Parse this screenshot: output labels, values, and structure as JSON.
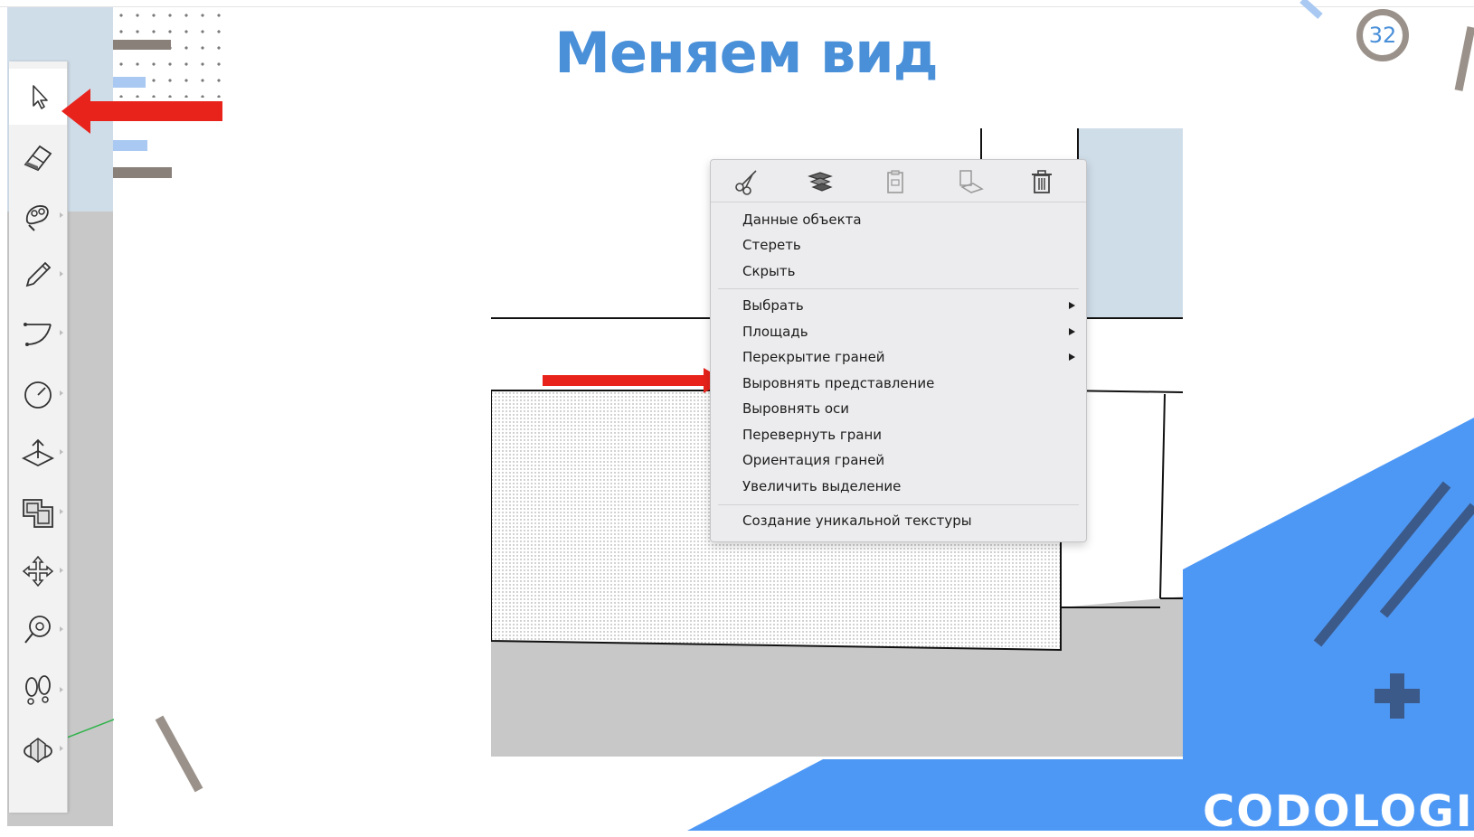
{
  "slide": {
    "title": "Меняем вид",
    "page_number": "32",
    "logo": "CODOLOGIA",
    "colors": {
      "title": "#4a90d9",
      "accent_blue": "#4e98f5",
      "dark_blue": "#3b5a8a",
      "arrow_red": "#e8231b",
      "gray": "#9a918a"
    }
  },
  "toolbar": {
    "tools": [
      {
        "name": "select",
        "icon": "select-arrow-icon",
        "selected": true
      },
      {
        "name": "eraser",
        "icon": "eraser-icon"
      },
      {
        "name": "paint-bucket",
        "icon": "paint-bucket-icon"
      },
      {
        "name": "line",
        "icon": "pencil-icon"
      },
      {
        "name": "arc",
        "icon": "arc-icon"
      },
      {
        "name": "circle",
        "icon": "circle-icon"
      },
      {
        "name": "push-pull",
        "icon": "push-pull-icon"
      },
      {
        "name": "offset",
        "icon": "offset-icon"
      },
      {
        "name": "move",
        "icon": "move-icon"
      },
      {
        "name": "tape-measure",
        "icon": "tape-measure-icon"
      },
      {
        "name": "walk",
        "icon": "footprints-icon"
      },
      {
        "name": "orbit",
        "icon": "orbit-icon"
      }
    ]
  },
  "context_menu": {
    "toolbar_icons": [
      "cut-icon",
      "copy-icon",
      "paste-icon",
      "paste-in-place-icon",
      "delete-icon"
    ],
    "group1": [
      "Данные объекта",
      "Стереть",
      "Скрыть"
    ],
    "group2": [
      "Выбрать",
      "Площадь",
      "Перекрытие граней",
      "Выровнять представление",
      "Выровнять оси",
      "Перевернуть грани",
      "Ориентация граней",
      "Увеличить выделение"
    ],
    "group3": [
      "Создание уникальной текстуры"
    ]
  }
}
